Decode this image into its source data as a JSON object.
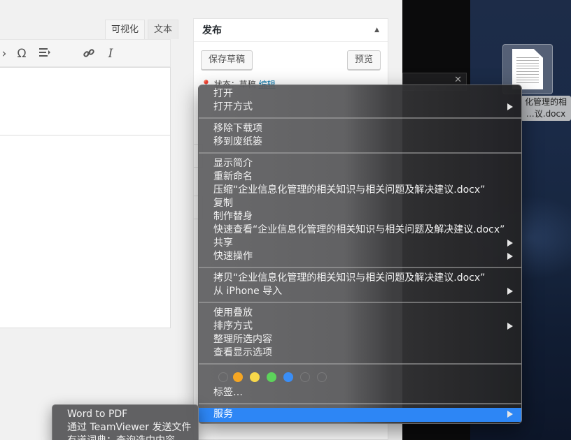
{
  "editor": {
    "tabs": [
      {
        "label": "可视化"
      },
      {
        "label": "文本"
      }
    ],
    "toolbar": {
      "omega": "Ω",
      "italic": "I"
    }
  },
  "publish": {
    "title": "发布",
    "save_draft": "保存草稿",
    "preview": "预览",
    "status_prefix": "状态：草稿",
    "status_edit": "编辑"
  },
  "desktop": {
    "file_label_line1": "化管理的相",
    "file_label_line2": "…议.docx"
  },
  "context_menu": {
    "items": [
      {
        "label": "打开",
        "has_submenu": false
      },
      {
        "label": "打开方式",
        "has_submenu": true
      },
      {
        "label": "移除下载项",
        "has_submenu": false
      },
      {
        "label": "移到废纸篓",
        "has_submenu": false
      },
      {
        "label": "显示简介",
        "has_submenu": false
      },
      {
        "label": "重新命名",
        "has_submenu": false
      },
      {
        "label": "压缩“企业信息化管理的相关知识与相关问题及解决建议.docx”",
        "has_submenu": false
      },
      {
        "label": "复制",
        "has_submenu": false
      },
      {
        "label": "制作替身",
        "has_submenu": false
      },
      {
        "label": "快速查看“企业信息化管理的相关知识与相关问题及解决建议.docx”",
        "has_submenu": false
      },
      {
        "label": "共享",
        "has_submenu": true
      },
      {
        "label": "快速操作",
        "has_submenu": true
      },
      {
        "label": "拷贝“企业信息化管理的相关知识与相关问题及解决建议.docx”",
        "has_submenu": false
      },
      {
        "label": "从 iPhone 导入",
        "has_submenu": true
      },
      {
        "label": "使用叠放",
        "has_submenu": false
      },
      {
        "label": "排序方式",
        "has_submenu": true
      },
      {
        "label": "整理所选内容",
        "has_submenu": false
      },
      {
        "label": "查看显示选项",
        "has_submenu": false
      },
      {
        "label": "标签…",
        "has_submenu": false
      },
      {
        "label": "服务",
        "has_submenu": true,
        "highlighted": true
      }
    ],
    "tag_colors": [
      "#f5a623",
      "#f8d84a",
      "#5dd35b",
      "#3a8ef7"
    ],
    "highlight_color": "#2d86f5"
  },
  "services_submenu": {
    "items": [
      {
        "label": "Word to PDF"
      },
      {
        "label": "通过 TeamViewer 发送文件"
      },
      {
        "label": "有道词典：查询选中内容"
      }
    ]
  }
}
